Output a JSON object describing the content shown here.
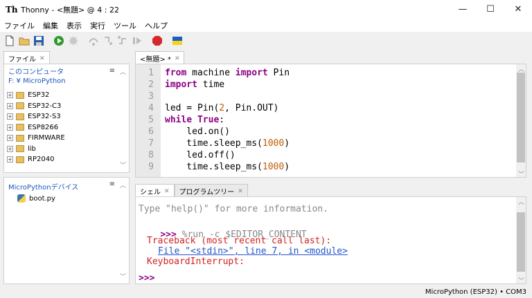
{
  "window": {
    "title": "Thonny  -  <無題>  @  4 : 22",
    "logo_text": "Th",
    "minimize": "—",
    "maximize": "☐",
    "close": "✕"
  },
  "menu": [
    "ファイル",
    "編集",
    "表示",
    "実行",
    "ツール",
    "ヘルプ"
  ],
  "toolbar": {
    "icons": [
      "new-file-icon",
      "open-file-icon",
      "save-icon",
      "run-icon",
      "debug-icon",
      "step-over-icon",
      "step-into-icon",
      "step-out-icon",
      "resume-icon",
      "stop-icon",
      "ukraine-flag-icon"
    ],
    "stop_label": "STOP"
  },
  "files_panel": {
    "tab": "ファイル",
    "computer_label": "このコンピュータ",
    "path": "F: ¥ MicroPython",
    "menu_icon": "≡",
    "folders": [
      "ESP32",
      "ESP32-C3",
      "ESP32-S3",
      "ESP8266",
      "FIRMWARE",
      "lib",
      "RP2040"
    ]
  },
  "devices_panel": {
    "title": "MicroPythonデバイス",
    "menu_icon": "≡",
    "files": [
      "boot.py"
    ]
  },
  "editor": {
    "tab": "<無題> *",
    "lines": [
      {
        "n": "1",
        "parts": [
          [
            "kw",
            "from"
          ],
          [
            "t",
            " machine "
          ],
          [
            "kw",
            "import"
          ],
          [
            "t",
            " Pin"
          ]
        ]
      },
      {
        "n": "2",
        "parts": [
          [
            "kw",
            "import"
          ],
          [
            "t",
            " time"
          ]
        ]
      },
      {
        "n": "3",
        "parts": []
      },
      {
        "n": "4",
        "parts": [
          [
            "t",
            "led = Pin("
          ],
          [
            "num",
            "2"
          ],
          [
            "t",
            ", Pin.OUT)"
          ]
        ]
      },
      {
        "n": "5",
        "parts": [
          [
            "kw",
            "while"
          ],
          [
            "t",
            " "
          ],
          [
            "kw",
            "True"
          ],
          [
            "t",
            ":"
          ]
        ]
      },
      {
        "n": "6",
        "parts": [
          [
            "t",
            "    led.on()"
          ]
        ]
      },
      {
        "n": "7",
        "parts": [
          [
            "t",
            "    time.sleep_ms("
          ],
          [
            "num",
            "1000"
          ],
          [
            "t",
            ")"
          ]
        ]
      },
      {
        "n": "8",
        "parts": [
          [
            "t",
            "    led.off()"
          ]
        ]
      },
      {
        "n": "9",
        "parts": [
          [
            "t",
            "    time.sleep_ms("
          ],
          [
            "num",
            "1000"
          ],
          [
            "t",
            ")"
          ]
        ]
      }
    ]
  },
  "shell": {
    "tabs": [
      "シェル",
      "プログラムツリー"
    ],
    "help_line": "Type \"help()\" for more information.",
    "prompt": ">>>",
    "command": " %run -c $EDITOR_CONTENT",
    "traceback": "Traceback (most recent call last):",
    "file_line": "File \"<stdin>\", line 7, in <module>",
    "error": "KeyboardInterrupt:",
    "last_prompt": ">>>"
  },
  "status": {
    "interpreter": "MicroPython (ESP32)  •  COM3"
  },
  "colors": {
    "keyword": "#8b0083",
    "number": "#c05a00",
    "error": "#d42020",
    "link": "#2255cc",
    "prompt": "#8b0083"
  }
}
